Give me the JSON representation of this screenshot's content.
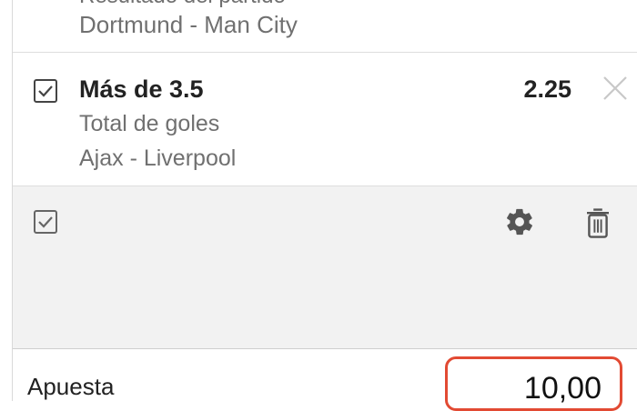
{
  "previous_bet": {
    "market_cut": "Resultado del partido",
    "match": "Dortmund - Man City"
  },
  "bet": {
    "checked": true,
    "selection": "Más de 3.5",
    "market": "Total de goles",
    "match": "Ajax - Liverpool",
    "odds": "2.25"
  },
  "toolbar": {
    "select_all_checked": true,
    "icons": [
      "checkbox-icon",
      "gear-icon",
      "trash-icon"
    ]
  },
  "stake": {
    "label": "Apuesta",
    "value": "10,00"
  },
  "colors": {
    "accent_border": "#e24a33",
    "secondary_text": "#707070",
    "toolbar_bg": "#f2f2f2"
  }
}
